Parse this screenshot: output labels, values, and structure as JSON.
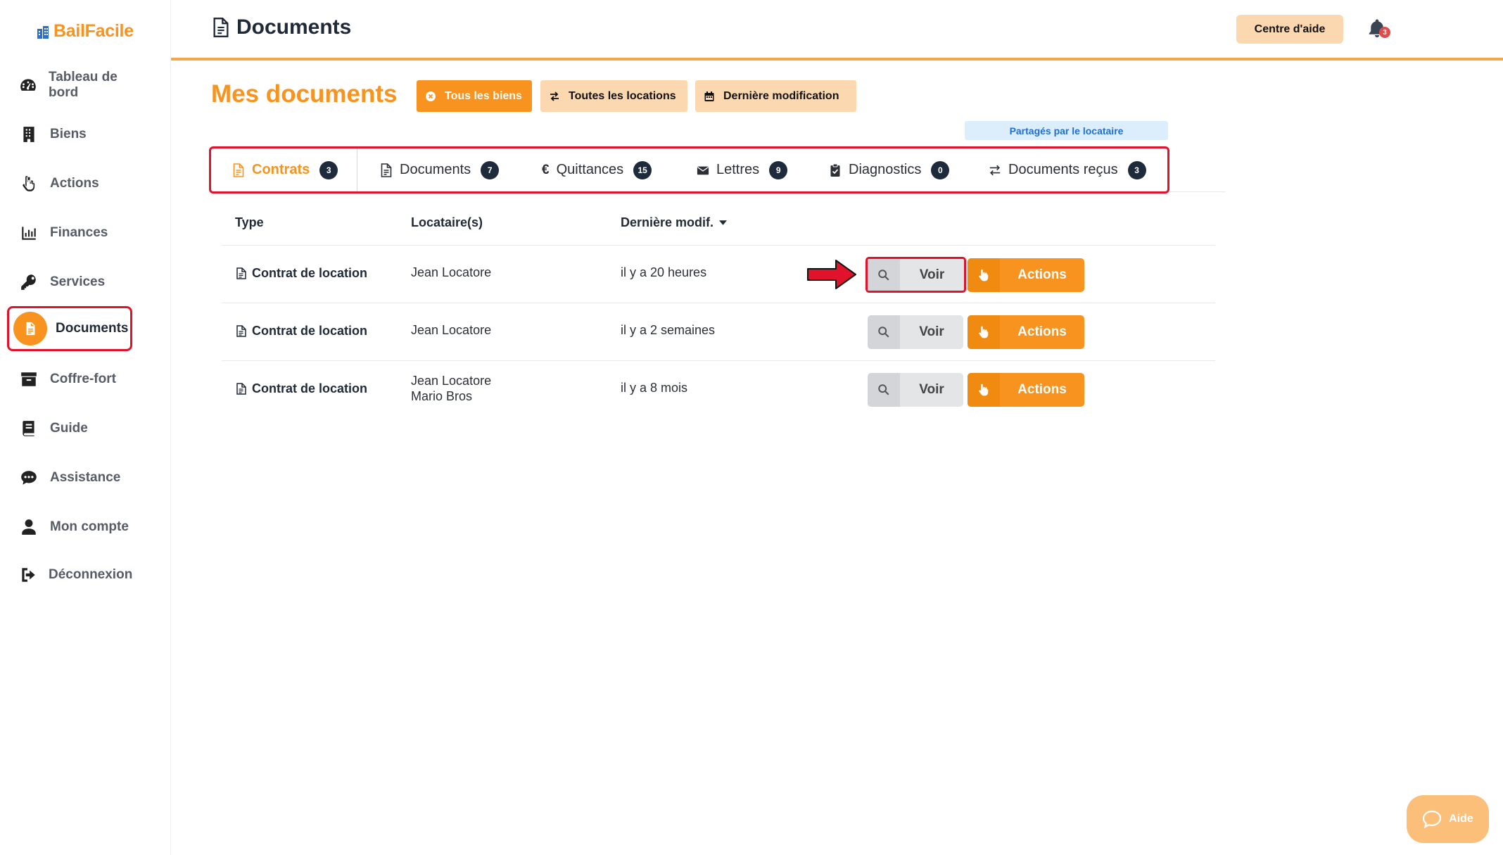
{
  "brand": {
    "name": "BailFacile",
    "color": "#f7931e"
  },
  "sidebar": {
    "items": [
      {
        "label": "Tableau de bord",
        "icon": "dashboard-icon"
      },
      {
        "label": "Biens",
        "icon": "building-icon"
      },
      {
        "label": "Actions",
        "icon": "hand-pointer-icon"
      },
      {
        "label": "Finances",
        "icon": "bar-chart-icon"
      },
      {
        "label": "Services",
        "icon": "key-icon"
      },
      {
        "label": "Documents",
        "icon": "document-icon",
        "active": true
      },
      {
        "label": "Coffre-fort",
        "icon": "archive-icon"
      },
      {
        "label": "Guide",
        "icon": "book-icon"
      },
      {
        "label": "Assistance",
        "icon": "chat-icon"
      },
      {
        "label": "Mon compte",
        "icon": "user-icon"
      },
      {
        "label": "Déconnexion",
        "icon": "logout-icon"
      }
    ]
  },
  "header": {
    "title": "Documents",
    "help_label": "Centre d'aide",
    "notification_count": "3"
  },
  "main": {
    "title": "Mes documents",
    "filters": {
      "properties": "Tous les biens",
      "rentals": "Toutes les locations",
      "sort": "Dernière modification"
    },
    "shared_label": "Partagés par le locataire"
  },
  "tabs": [
    {
      "label": "Contrats",
      "count": "3",
      "active": true
    },
    {
      "label": "Documents",
      "count": "7"
    },
    {
      "label": "Quittances",
      "count": "15"
    },
    {
      "label": "Lettres",
      "count": "9"
    },
    {
      "label": "Diagnostics",
      "count": "0"
    },
    {
      "label": "Documents reçus",
      "count": "3"
    }
  ],
  "table": {
    "headers": {
      "type": "Type",
      "tenants": "Locataire(s)",
      "modified": "Dernière modif."
    },
    "rows": [
      {
        "type": "Contrat de location",
        "tenants": [
          "Jean Locatore"
        ],
        "modified": "il y a 20 heures",
        "view": "Voir",
        "actions": "Actions"
      },
      {
        "type": "Contrat de location",
        "tenants": [
          "Jean Locatore"
        ],
        "modified": "il y a 2 semaines",
        "view": "Voir",
        "actions": "Actions"
      },
      {
        "type": "Contrat de location",
        "tenants": [
          "Jean Locatore",
          "Mario Bros"
        ],
        "modified": "il y a 8 mois",
        "view": "Voir",
        "actions": "Actions"
      }
    ]
  },
  "help_widget": {
    "label": "Aide"
  },
  "colors": {
    "accent": "#f7931e",
    "accent_light": "#fbd8b0",
    "highlight": "#e1122b",
    "badge_dark": "#1e2b3c"
  }
}
